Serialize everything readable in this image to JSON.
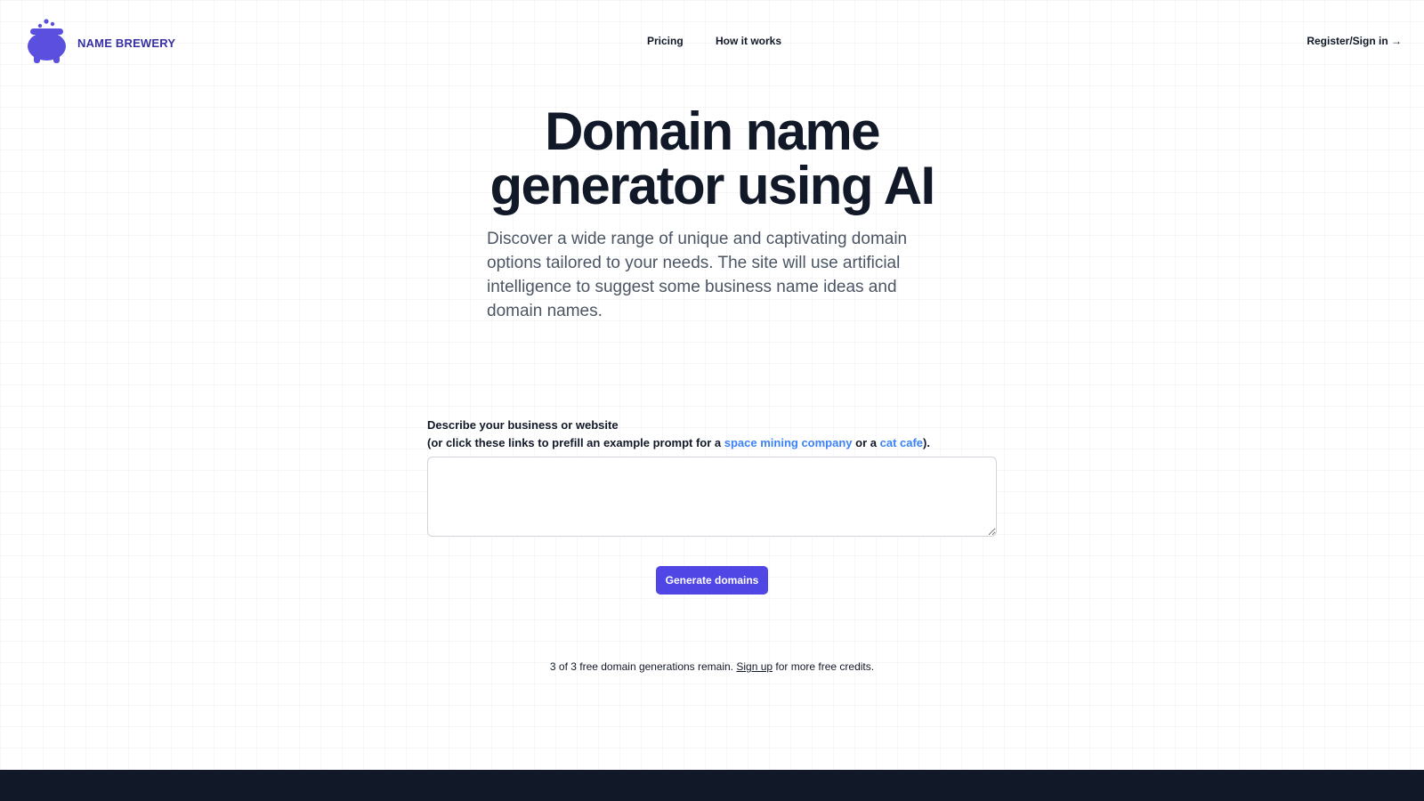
{
  "colors": {
    "brand": "#4f46e5",
    "logo": "#5b4fe0",
    "heading": "#111827",
    "subtext": "#4b5563",
    "link": "#3b82f6",
    "footer": "#111827"
  },
  "header": {
    "brand_name": "NAME BREWERY",
    "logo_icon": "cauldron-icon",
    "nav": {
      "pricing": "Pricing",
      "how_it_works": "How it works"
    },
    "auth_label": "Register/Sign in →"
  },
  "hero": {
    "title": "Domain name generator using AI",
    "subtitle": "Discover a wide range of unique and captivating domain options tailored to your needs. The site will use artificial intelligence to suggest some business name ideas and domain names."
  },
  "form": {
    "label": "Describe your business or website",
    "hint_prefix": "(or click these links to prefill an example prompt for a ",
    "example_1": "space mining company",
    "hint_middle": " or a ",
    "example_2": "cat cafe",
    "hint_suffix": ").",
    "prompt_value": "",
    "prompt_placeholder": "",
    "generate_label": "Generate domains"
  },
  "credits": {
    "text_before": "3 of 3 free domain generations remain. ",
    "signup_label": "Sign up",
    "text_after": " for more free credits."
  }
}
